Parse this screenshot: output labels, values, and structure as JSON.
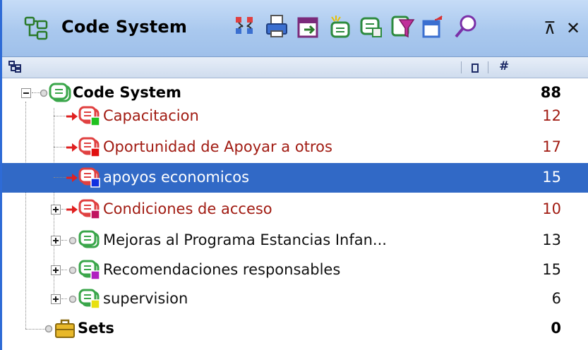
{
  "header": {
    "title": "Code System",
    "pin_glyph": "⊼",
    "close_glyph": "✕",
    "toolbar": [
      {
        "name": "collapse-all-icon",
        "color": "#d93030"
      },
      {
        "name": "print-icon",
        "color": "#3b6fd0"
      },
      {
        "name": "export-icon",
        "color": "#7a2a7a"
      },
      {
        "name": "new-code-icon",
        "color": "#2c8a3e"
      },
      {
        "name": "code-frequency-icon",
        "color": "#2c8a3e"
      },
      {
        "name": "filter-icon",
        "color": "#c0309a"
      },
      {
        "name": "transfer-icon",
        "color": "#3b6fd0"
      },
      {
        "name": "search-icon",
        "color": "#7a30a8"
      }
    ]
  },
  "columns": {
    "tree_icon": "tree-structure-icon",
    "color_col_icon": "color-square-icon",
    "count_col": "#"
  },
  "tree": {
    "root": {
      "label": "Code System",
      "count": "88"
    },
    "items": [
      {
        "label": "Capacitacion",
        "count": "12",
        "swatch": "#1fc11f",
        "activated": true
      },
      {
        "label": "Oportunidad de Apoyar a otros",
        "count": "17",
        "swatch": "#e01010",
        "activated": true
      },
      {
        "label": "apoyos economicos",
        "count": "15",
        "swatch": "#1030e0",
        "activated": true,
        "selected": true
      },
      {
        "label": "Condiciones de acceso",
        "count": "10",
        "swatch": "#c01560",
        "activated": true
      },
      {
        "label": "Mejoras al Programa Estancias Infan...",
        "count": "13",
        "swatch": "",
        "activated": false
      },
      {
        "label": "Recomendaciones responsables",
        "count": "15",
        "swatch": "#b020c0",
        "activated": false
      },
      {
        "label": "supervision",
        "count": "6",
        "swatch": "#e8e010",
        "activated": false
      }
    ],
    "sets": {
      "label": "Sets",
      "count": "0"
    }
  },
  "colors": {
    "selection": "#3169c6",
    "code_red_text": "#a11b12",
    "code_icon_green": "#3aa64a",
    "code_icon_red": "#e04040"
  }
}
